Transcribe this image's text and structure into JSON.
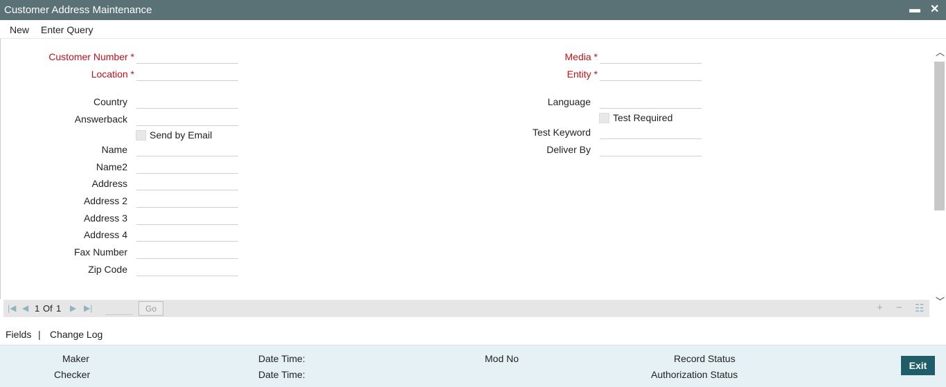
{
  "window": {
    "title": "Customer Address Maintenance",
    "minimize_glyph": "▬",
    "close_glyph": "✕"
  },
  "menu": {
    "new": "New",
    "enter_query": "Enter Query"
  },
  "form": {
    "customer_number": {
      "label": "Customer Number",
      "req": "*",
      "value": ""
    },
    "location": {
      "label": "Location",
      "req": "*",
      "value": ""
    },
    "country": {
      "label": "Country",
      "value": ""
    },
    "answerback": {
      "label": "Answerback",
      "value": ""
    },
    "send_by_email": {
      "label": "Send by Email",
      "checked": false
    },
    "name": {
      "label": "Name",
      "value": ""
    },
    "name2": {
      "label": "Name2",
      "value": ""
    },
    "address": {
      "label": "Address",
      "value": ""
    },
    "address2": {
      "label": "Address 2",
      "value": ""
    },
    "address3": {
      "label": "Address 3",
      "value": ""
    },
    "address4": {
      "label": "Address 4",
      "value": ""
    },
    "fax_number": {
      "label": "Fax Number",
      "value": ""
    },
    "zip_code": {
      "label": "Zip Code",
      "value": ""
    },
    "media": {
      "label": "Media",
      "req": "*",
      "value": ""
    },
    "entity": {
      "label": "Entity",
      "req": "*",
      "value": ""
    },
    "language": {
      "label": "Language",
      "value": ""
    },
    "test_required": {
      "label": "Test Required",
      "checked": false
    },
    "test_keyword": {
      "label": "Test Keyword",
      "value": ""
    },
    "deliver_by": {
      "label": "Deliver By",
      "value": ""
    }
  },
  "pager": {
    "current": "1",
    "of_label": "Of",
    "total": "1",
    "go_label": "Go",
    "first_icon": "first-page-icon",
    "prev_icon": "prev-page-icon",
    "next_icon": "next-page-icon",
    "last_icon": "last-page-icon",
    "add_icon": "add-row-icon",
    "delete_icon": "delete-row-icon",
    "list_icon": "list-view-icon"
  },
  "tabs": {
    "fields": "Fields",
    "separator": "|",
    "change_log": "Change Log"
  },
  "audit": {
    "maker": "Maker",
    "checker": "Checker",
    "date_time_1": "Date Time:",
    "date_time_2": "Date Time:",
    "mod_no": "Mod No",
    "record_status": "Record Status",
    "authorization_status": "Authorization Status"
  },
  "exit_label": "Exit",
  "colors": {
    "titlebar": "#5a7176",
    "required": "#c0101a",
    "footer": "#e5f1f4",
    "exit_button": "#1f5d68"
  }
}
